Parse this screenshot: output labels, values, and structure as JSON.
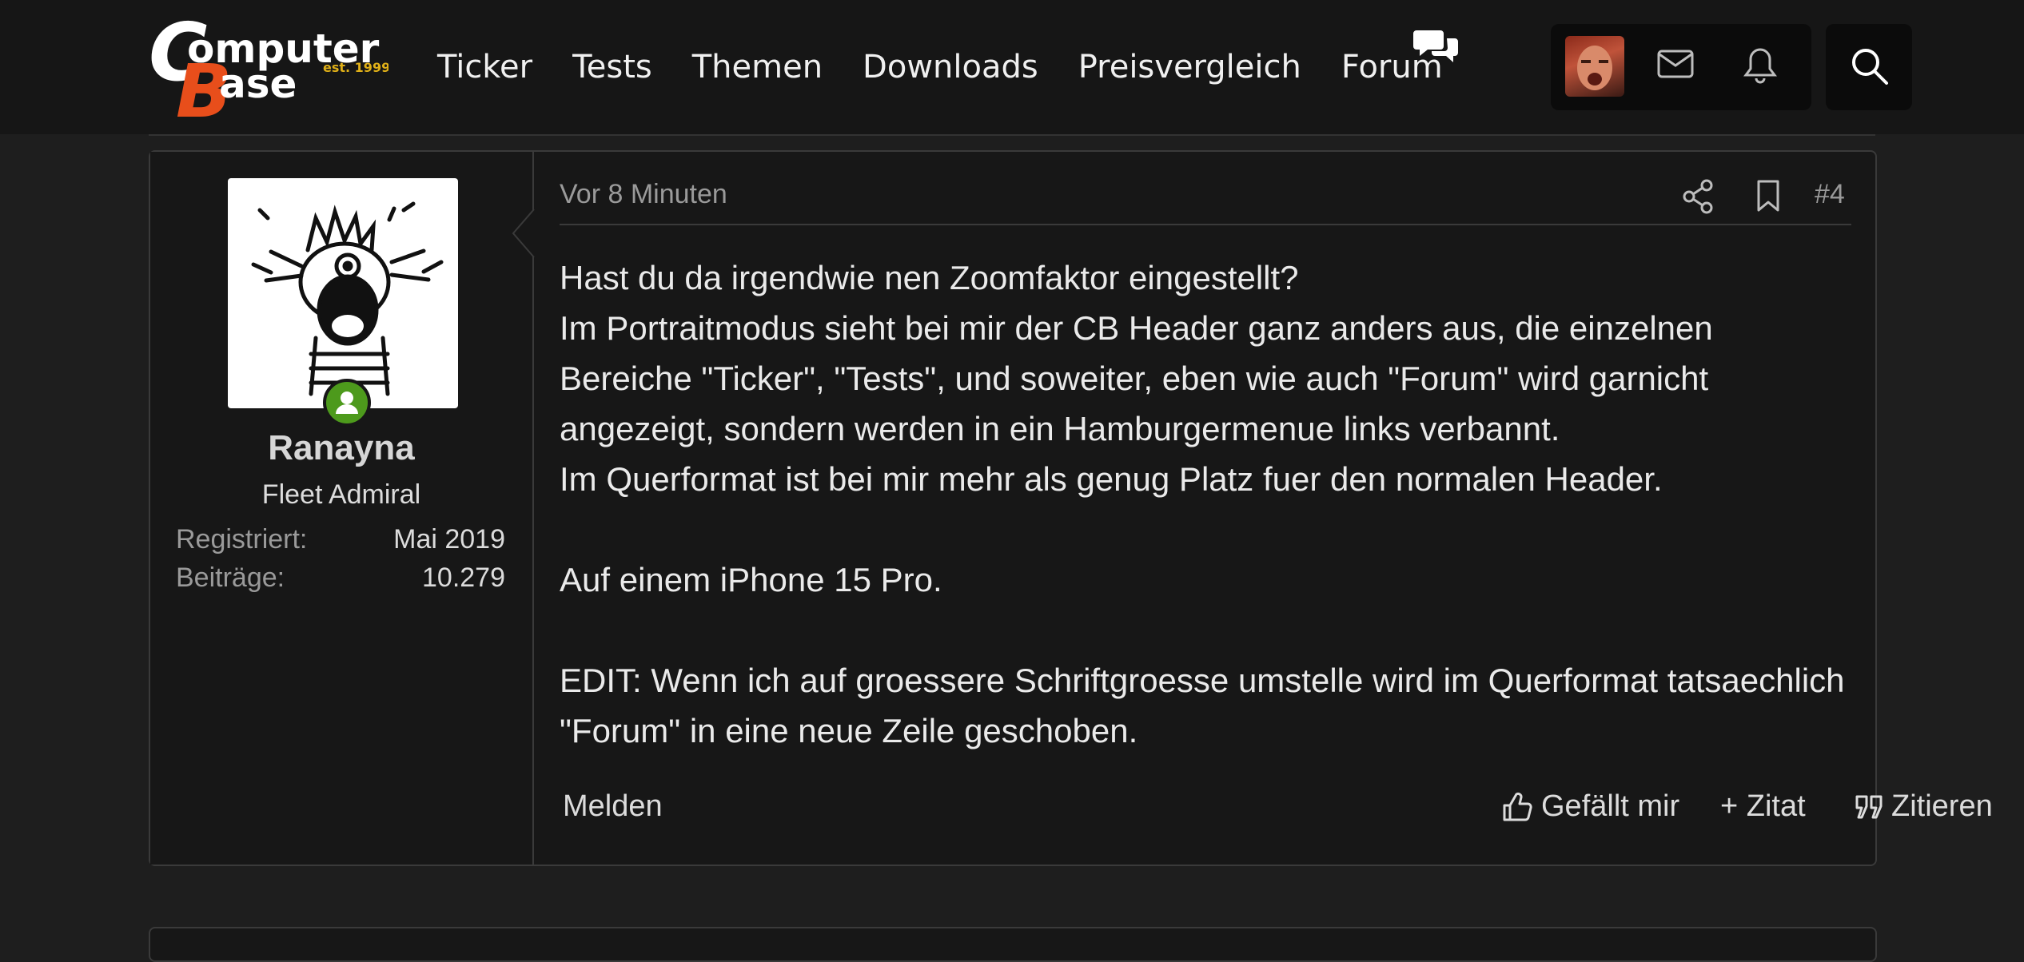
{
  "logo": {
    "line1": "omputer",
    "line2": "ase",
    "tagline": "est. 1999",
    "letter_c": "C",
    "letter_b": "B"
  },
  "nav": {
    "items": [
      "Ticker",
      "Tests",
      "Themen",
      "Downloads",
      "Preisvergleich",
      "Forum"
    ]
  },
  "icons": {
    "forum": "chat-bubbles-icon",
    "mail": "mail-icon",
    "bell": "bell-icon",
    "search": "search-icon",
    "share": "share-icon",
    "bookmark": "bookmark-icon",
    "like": "thumbs-up-icon",
    "quote": "quote-icon"
  },
  "colors": {
    "background": "#1e1e1e",
    "header": "#161616",
    "online": "#4d9a1c",
    "brand_orange": "#e84e1b",
    "brand_yellow": "#e0b018"
  },
  "post": {
    "time": "Vor 8 Minuten",
    "number": "#4",
    "author": {
      "name": "Ranayna",
      "rank": "Fleet Admiral",
      "registered_label": "Registriert:",
      "registered_value": "Mai 2019",
      "posts_label": "Beiträge:",
      "posts_value": "10.279"
    },
    "body": [
      "Hast du da irgendwie nen Zoomfaktor eingestellt?",
      "Im Portraitmodus sieht bei mir der CB Header ganz anders aus, die einzelnen Bereiche \"Ticker\", \"Tests\", und soweiter, eben wie auch \"Forum\" wird garnicht angezeigt, sondern werden in ein Hamburgermenue links verbannt.",
      "Im Querformat ist bei mir mehr als genug Platz fuer den normalen Header.",
      "Auf einem iPhone 15 Pro.",
      "EDIT: Wenn ich auf groessere Schriftgroesse umstelle wird im Querformat tatsaechlich \"Forum\" in eine neue Zeile geschoben."
    ],
    "actions": {
      "report": "Melden",
      "like": "Gefällt mir",
      "add_quote": "+ Zitat",
      "quote": "Zitieren"
    }
  }
}
